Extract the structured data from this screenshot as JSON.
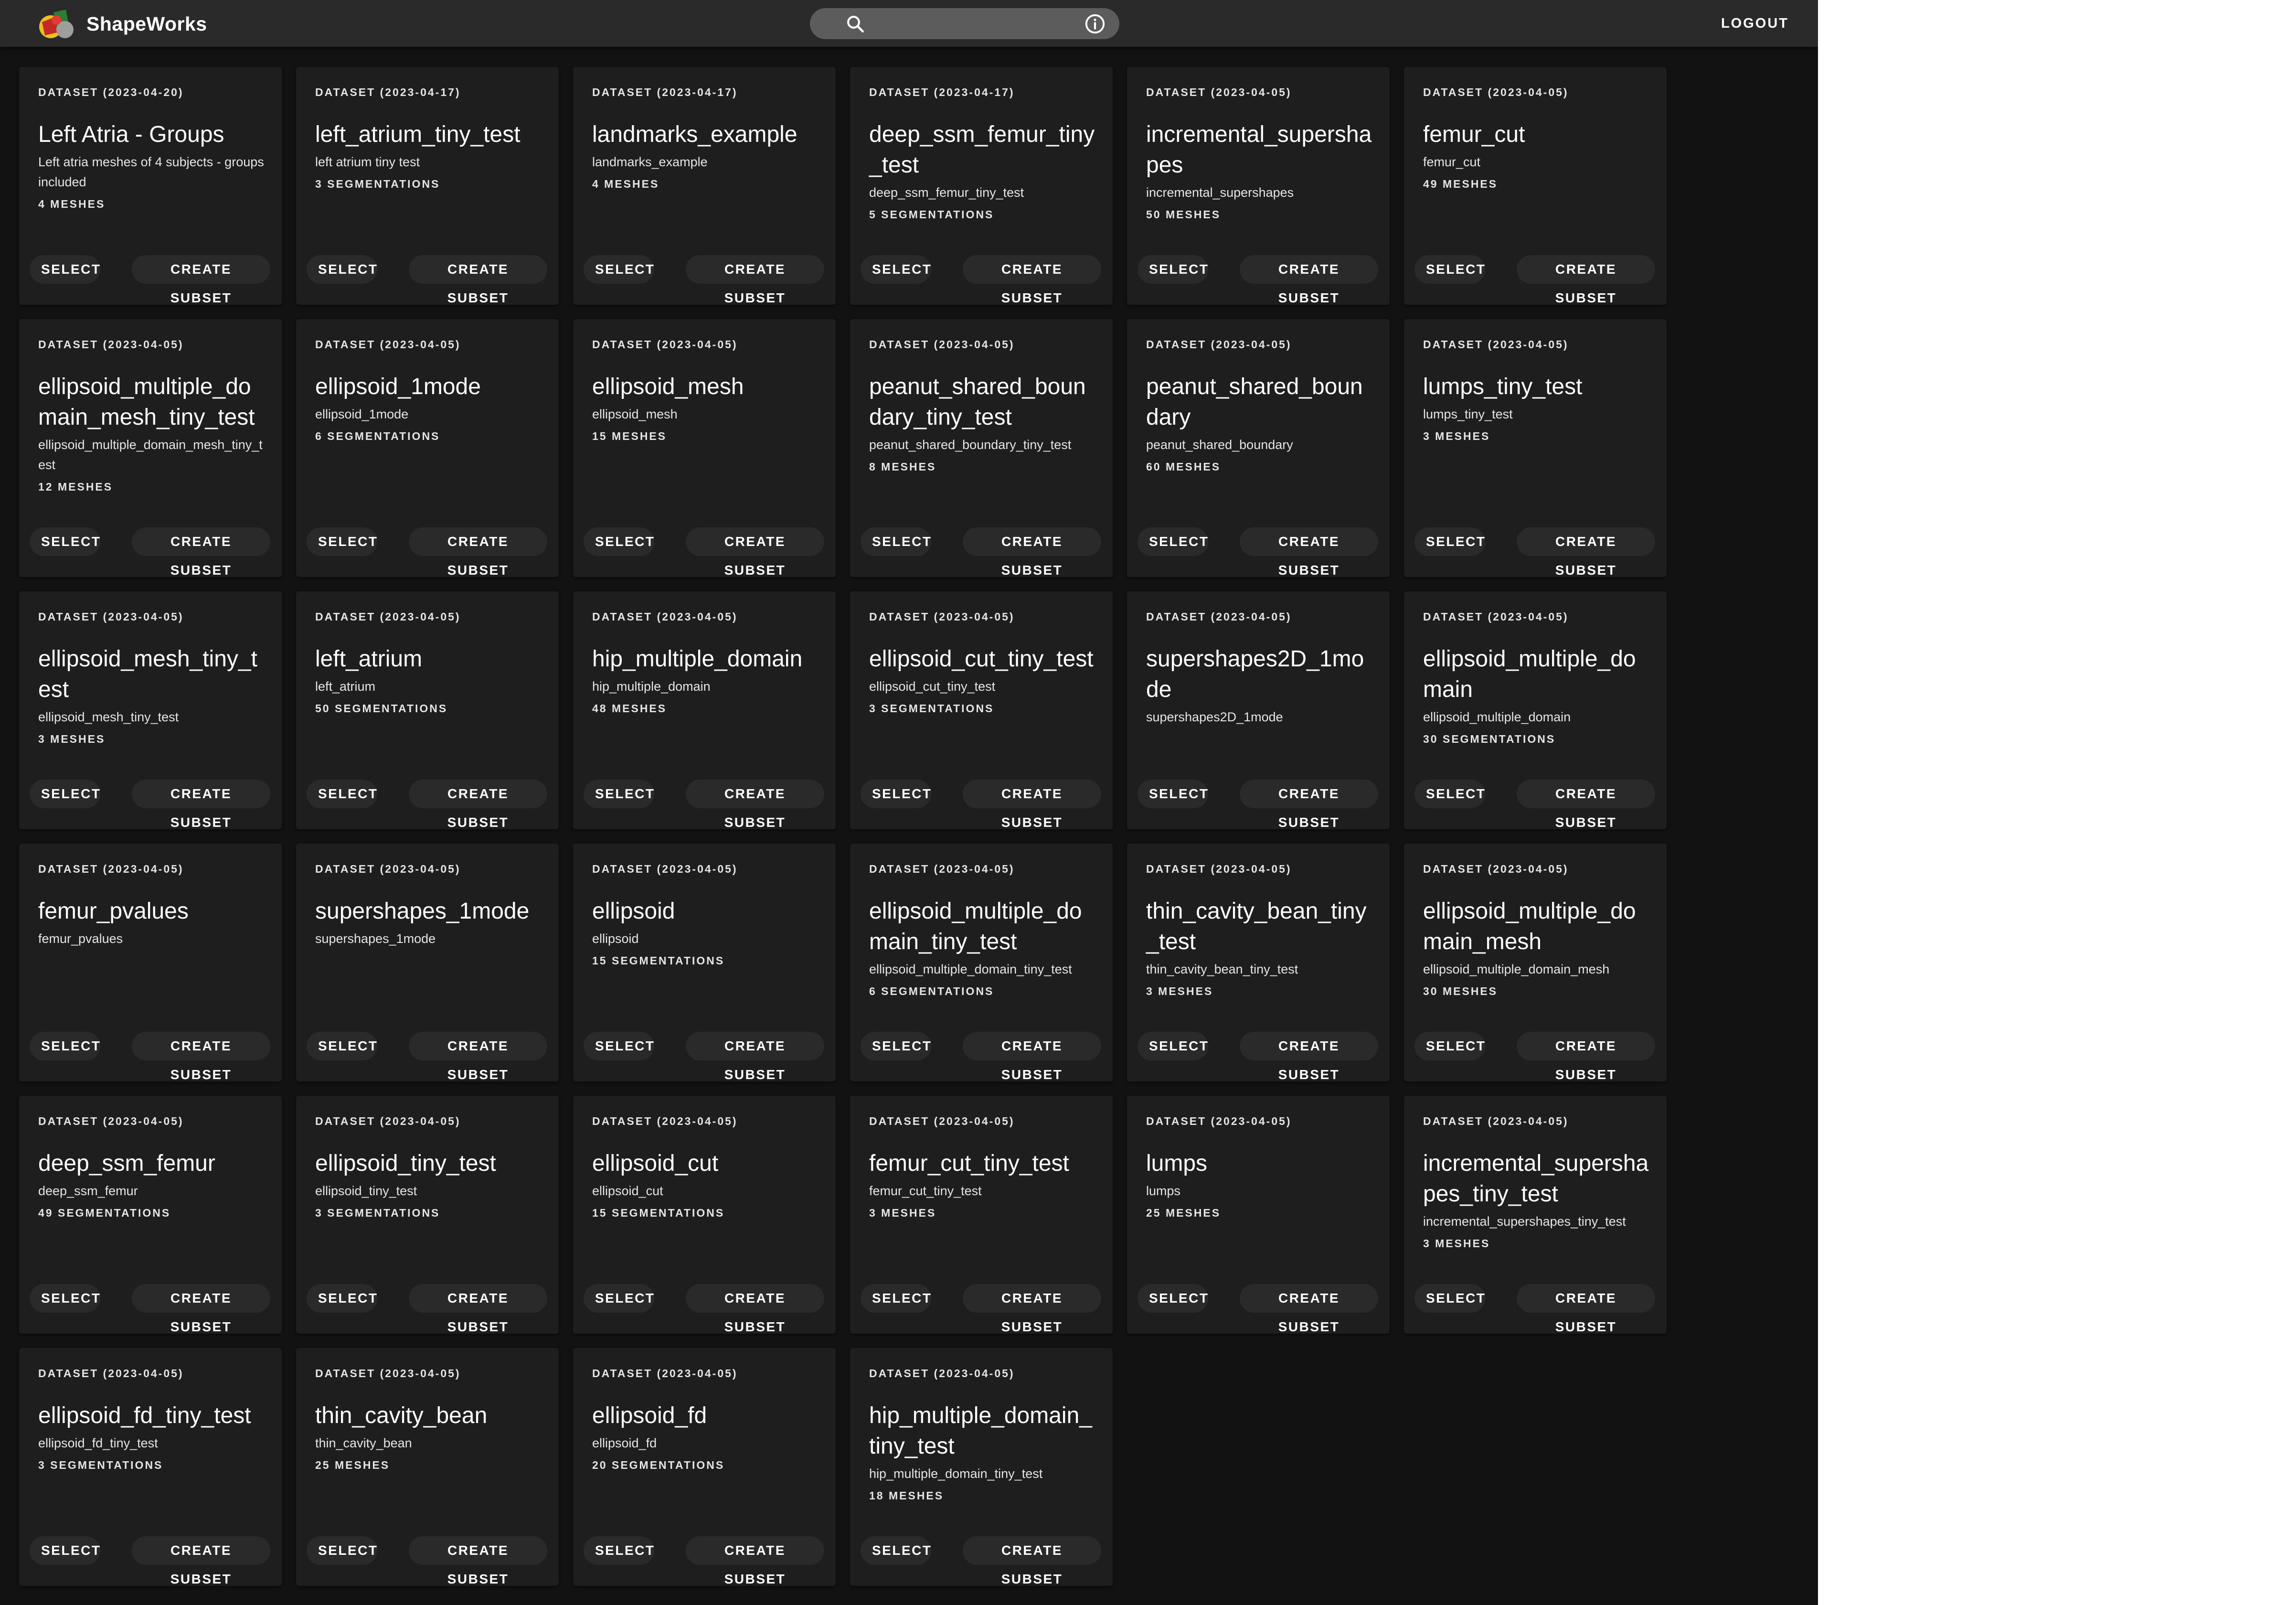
{
  "app": {
    "title": "ShapeWorks",
    "logout_label": "LOGOUT",
    "search": {
      "value": "",
      "placeholder": ""
    },
    "icons": {
      "logo": "shapeworks-logo",
      "search": "search-icon",
      "info": "info-icon"
    },
    "colors": {
      "background": "#121212",
      "topbar": "#2a2a2a",
      "card": "#1e1e1e",
      "search_field": "#5c5c5c",
      "text": "#ffffff"
    }
  },
  "card_labels": {
    "select": "SELECT",
    "create_subset": "CREATE SUBSET"
  },
  "datasets": [
    {
      "overline": "DATASET (2023-04-20)",
      "name": "Left Atria - Groups",
      "description": "Left atria meshes of 4 subjects - groups included",
      "count": "4 MESHES"
    },
    {
      "overline": "DATASET (2023-04-17)",
      "name": "left_atrium_tiny_test",
      "description": "left atrium tiny test",
      "count": "3 SEGMENTATIONS"
    },
    {
      "overline": "DATASET (2023-04-17)",
      "name": "landmarks_example",
      "description": "landmarks_example",
      "count": "4 MESHES"
    },
    {
      "overline": "DATASET (2023-04-17)",
      "name": "deep_ssm_femur_tiny_test",
      "description": "deep_ssm_femur_tiny_test",
      "count": "5 SEGMENTATIONS"
    },
    {
      "overline": "DATASET (2023-04-05)",
      "name": "incremental_supershapes",
      "description": "incremental_supershapes",
      "count": "50 MESHES"
    },
    {
      "overline": "DATASET (2023-04-05)",
      "name": "femur_cut",
      "description": "femur_cut",
      "count": "49 MESHES"
    },
    {
      "overline": "DATASET (2023-04-05)",
      "name": "ellipsoid_multiple_domain_mesh_tiny_test",
      "description": "ellipsoid_multiple_domain_mesh_tiny_test",
      "count": "12 MESHES"
    },
    {
      "overline": "DATASET (2023-04-05)",
      "name": "ellipsoid_1mode",
      "description": "ellipsoid_1mode",
      "count": "6 SEGMENTATIONS"
    },
    {
      "overline": "DATASET (2023-04-05)",
      "name": "ellipsoid_mesh",
      "description": "ellipsoid_mesh",
      "count": "15 MESHES"
    },
    {
      "overline": "DATASET (2023-04-05)",
      "name": "peanut_shared_boundary_tiny_test",
      "description": "peanut_shared_boundary_tiny_test",
      "count": "8 MESHES"
    },
    {
      "overline": "DATASET (2023-04-05)",
      "name": "peanut_shared_boundary",
      "description": "peanut_shared_boundary",
      "count": "60 MESHES"
    },
    {
      "overline": "DATASET (2023-04-05)",
      "name": "lumps_tiny_test",
      "description": "lumps_tiny_test",
      "count": "3 MESHES"
    },
    {
      "overline": "DATASET (2023-04-05)",
      "name": "ellipsoid_mesh_tiny_test",
      "description": "ellipsoid_mesh_tiny_test",
      "count": "3 MESHES"
    },
    {
      "overline": "DATASET (2023-04-05)",
      "name": "left_atrium",
      "description": "left_atrium",
      "count": "50 SEGMENTATIONS"
    },
    {
      "overline": "DATASET (2023-04-05)",
      "name": "hip_multiple_domain",
      "description": "hip_multiple_domain",
      "count": "48 MESHES"
    },
    {
      "overline": "DATASET (2023-04-05)",
      "name": "ellipsoid_cut_tiny_test",
      "description": "ellipsoid_cut_tiny_test",
      "count": "3 SEGMENTATIONS"
    },
    {
      "overline": "DATASET (2023-04-05)",
      "name": "supershapes2D_1mode",
      "description": "supershapes2D_1mode",
      "count": ""
    },
    {
      "overline": "DATASET (2023-04-05)",
      "name": "ellipsoid_multiple_domain",
      "description": "ellipsoid_multiple_domain",
      "count": "30 SEGMENTATIONS"
    },
    {
      "overline": "DATASET (2023-04-05)",
      "name": "femur_pvalues",
      "description": "femur_pvalues",
      "count": ""
    },
    {
      "overline": "DATASET (2023-04-05)",
      "name": "supershapes_1mode",
      "description": "supershapes_1mode",
      "count": ""
    },
    {
      "overline": "DATASET (2023-04-05)",
      "name": "ellipsoid",
      "description": "ellipsoid",
      "count": "15 SEGMENTATIONS"
    },
    {
      "overline": "DATASET (2023-04-05)",
      "name": "ellipsoid_multiple_domain_tiny_test",
      "description": "ellipsoid_multiple_domain_tiny_test",
      "count": "6 SEGMENTATIONS"
    },
    {
      "overline": "DATASET (2023-04-05)",
      "name": "thin_cavity_bean_tiny_test",
      "description": "thin_cavity_bean_tiny_test",
      "count": "3 MESHES"
    },
    {
      "overline": "DATASET (2023-04-05)",
      "name": "ellipsoid_multiple_domain_mesh",
      "description": "ellipsoid_multiple_domain_mesh",
      "count": "30 MESHES"
    },
    {
      "overline": "DATASET (2023-04-05)",
      "name": "deep_ssm_femur",
      "description": "deep_ssm_femur",
      "count": "49 SEGMENTATIONS"
    },
    {
      "overline": "DATASET (2023-04-05)",
      "name": "ellipsoid_tiny_test",
      "description": "ellipsoid_tiny_test",
      "count": "3 SEGMENTATIONS"
    },
    {
      "overline": "DATASET (2023-04-05)",
      "name": "ellipsoid_cut",
      "description": "ellipsoid_cut",
      "count": "15 SEGMENTATIONS"
    },
    {
      "overline": "DATASET (2023-04-05)",
      "name": "femur_cut_tiny_test",
      "description": "femur_cut_tiny_test",
      "count": "3 MESHES"
    },
    {
      "overline": "DATASET (2023-04-05)",
      "name": "lumps",
      "description": "lumps",
      "count": "25 MESHES"
    },
    {
      "overline": "DATASET (2023-04-05)",
      "name": "incremental_supershapes_tiny_test",
      "description": "incremental_supershapes_tiny_test",
      "count": "3 MESHES"
    },
    {
      "overline": "DATASET (2023-04-05)",
      "name": "ellipsoid_fd_tiny_test",
      "description": "ellipsoid_fd_tiny_test",
      "count": "3 SEGMENTATIONS"
    },
    {
      "overline": "DATASET (2023-04-05)",
      "name": "thin_cavity_bean",
      "description": "thin_cavity_bean",
      "count": "25 MESHES"
    },
    {
      "overline": "DATASET (2023-04-05)",
      "name": "ellipsoid_fd",
      "description": "ellipsoid_fd",
      "count": "20 SEGMENTATIONS"
    },
    {
      "overline": "DATASET (2023-04-05)",
      "name": "hip_multiple_domain_tiny_test",
      "description": "hip_multiple_domain_tiny_test",
      "count": "18 MESHES"
    }
  ]
}
